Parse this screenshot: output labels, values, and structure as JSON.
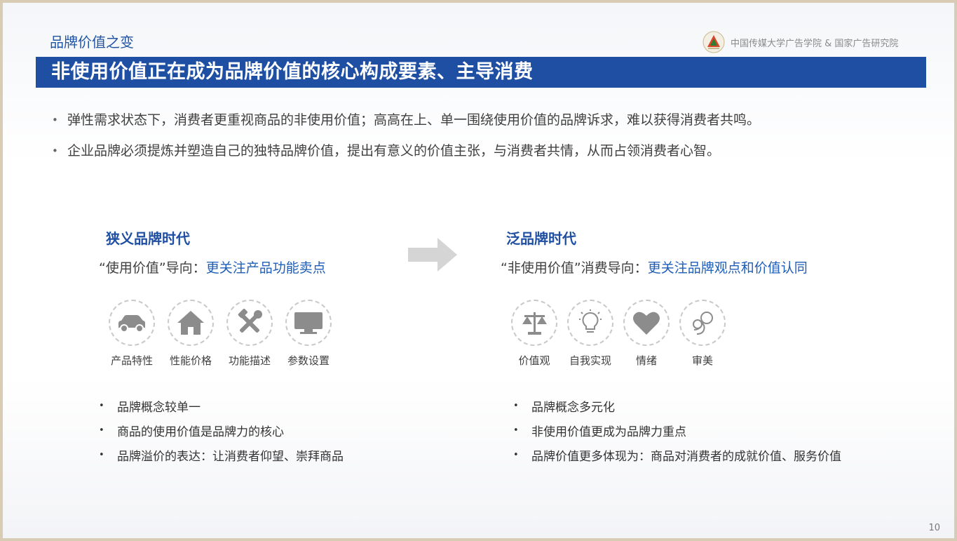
{
  "header": {
    "section_label": "品牌价值之变",
    "org": "中国传媒大学广告学院 & 国家广告研究院",
    "title": "非使用价值正在成为品牌价值的核心构成要素、主导消费"
  },
  "intro_bullets": [
    "弹性需求状态下，消费者更重视商品的非使用价值；高高在上、单一围绕使用价值的品牌诉求，难以获得消费者共鸣。",
    "企业品牌必须提炼并塑造自己的独特品牌价值，提出有意义的价值主张，与消费者共情，从而占领消费者心智。"
  ],
  "left": {
    "title": "狭义品牌时代",
    "sub_prefix": "“使用价值”导向：",
    "sub_highlight": "更关注产品功能卖点",
    "icons": [
      {
        "label": "产品特性",
        "icon": "car-icon"
      },
      {
        "label": "性能价格",
        "icon": "house-icon"
      },
      {
        "label": "功能描述",
        "icon": "tools-icon"
      },
      {
        "label": "参数设置",
        "icon": "monitor-icon"
      }
    ],
    "bullets": [
      "品牌概念较单一",
      "商品的使用价值是品牌力的核心",
      "品牌溢价的表达：让消费者仰望、崇拜商品"
    ]
  },
  "right": {
    "title": "泛品牌时代",
    "sub_prefix": "“非使用价值”消费导向：",
    "sub_highlight": "更关注品牌观点和价值认同",
    "icons": [
      {
        "label": "价值观",
        "icon": "scale-icon"
      },
      {
        "label": "自我实现",
        "icon": "lightbulb-icon"
      },
      {
        "label": "情绪",
        "icon": "heart-icon"
      },
      {
        "label": "审美",
        "icon": "flower-icon"
      }
    ],
    "bullets": [
      "品牌概念多元化",
      "非使用价值更成为品牌力重点",
      "品牌价值更多体现为：商品对消费者的成就价值、服务价值"
    ]
  },
  "colors": {
    "brand_blue": "#1f4fa3",
    "highlight_blue": "#1f5eb8",
    "icon_gray": "#8c8c8c",
    "frame_border": "#d8cdb4"
  },
  "page_number": "10"
}
